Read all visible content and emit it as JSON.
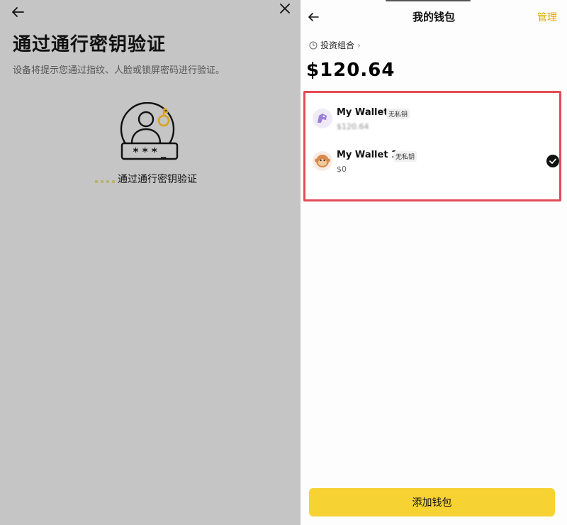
{
  "left": {
    "title": "通过通行密钥验证",
    "subtitle": "设备将提示您通过指纹、人脸或锁屏密码进行验证。",
    "passkey_pin": "* * * _",
    "loading_text": "通过通行密钥验证"
  },
  "right": {
    "title": "我的钱包",
    "manage_label": "管理",
    "portfolio_label": "投资组合",
    "portfolio_chevron": "›",
    "balance": "$120.64",
    "wallets": [
      {
        "name": "My Wallet",
        "badge": "无私钥",
        "value": "$120.64",
        "selected": false
      },
      {
        "name": "My Wallet 1",
        "badge": "无私钥",
        "value": "$0",
        "selected": true
      }
    ],
    "add_wallet_label": "添加钱包"
  },
  "colors": {
    "accent_yellow": "#f6d233",
    "manage_color": "#e0a800",
    "highlight_border": "#e34b55",
    "left_background": "#c5c5c5"
  },
  "icons": {
    "left_back": "arrow-left-icon",
    "left_close": "close-icon",
    "passkey": "passkey-user-key-icon",
    "right_back": "arrow-left-icon",
    "portfolio": "clock-icon",
    "wallet_0_avatar": "unicorn-avatar-icon",
    "wallet_1_avatar": "monkey-avatar-icon",
    "selected": "check-circle-icon"
  }
}
